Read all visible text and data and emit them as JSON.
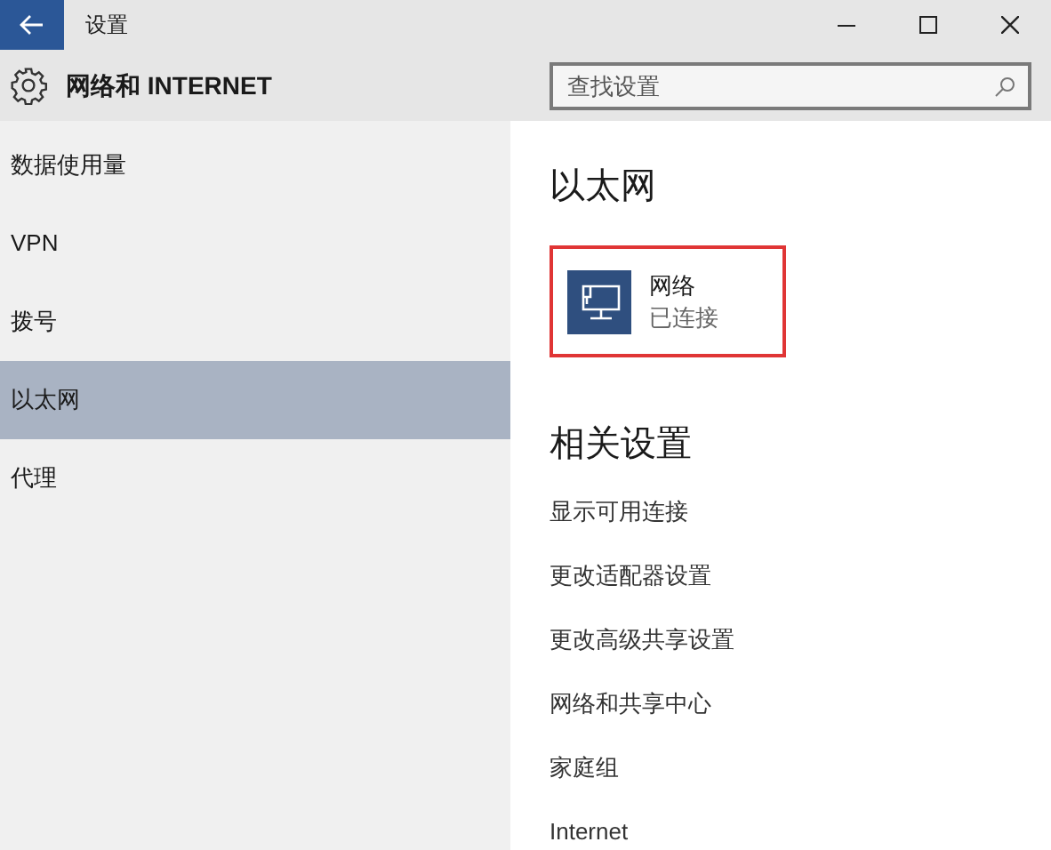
{
  "window": {
    "title": "设置"
  },
  "header": {
    "title": "网络和 INTERNET"
  },
  "search": {
    "placeholder": "查找设置"
  },
  "sidebar": {
    "items": [
      {
        "label": "数据使用量",
        "selected": false
      },
      {
        "label": "VPN",
        "selected": false
      },
      {
        "label": "拨号",
        "selected": false
      },
      {
        "label": "以太网",
        "selected": true
      },
      {
        "label": "代理",
        "selected": false
      }
    ]
  },
  "main": {
    "title": "以太网",
    "network": {
      "name": "网络",
      "status": "已连接",
      "highlighted": true
    },
    "related_title": "相关设置",
    "links": [
      "显示可用连接",
      "更改适配器设置",
      "更改高级共享设置",
      "网络和共享中心",
      "家庭组",
      "Internet"
    ]
  }
}
